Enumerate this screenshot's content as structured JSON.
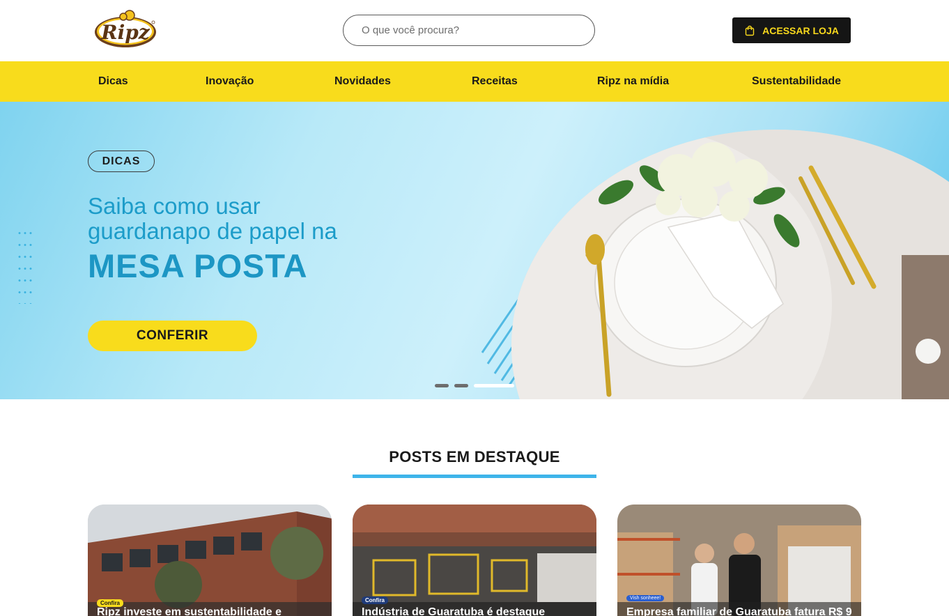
{
  "header": {
    "logo_text": "Ripz",
    "search_placeholder": "O que você procura?",
    "store_button": "ACESSAR LOJA"
  },
  "nav": {
    "items": [
      "Dicas",
      "Inovação",
      "Novidades",
      "Receitas",
      "Ripz na mídia",
      "Sustentabilidade"
    ]
  },
  "hero": {
    "tag": "DICAS",
    "line1": "Saiba como usar",
    "line2": "guardanapo de papel na",
    "line3": "MESA POSTA",
    "cta": "CONFERIR",
    "slides_total": 3,
    "active_slide": 3
  },
  "posts": {
    "section_title": "POSTS EM DESTAQUE",
    "cards": [
      {
        "badge": "Confira",
        "title": "Ripz investe em sustentabilidade e"
      },
      {
        "badge": "Confira",
        "title": "Indústria de Guaratuba é destaque"
      },
      {
        "badge": "Vish sonheee!",
        "title": "Empresa familiar de Guaratuba fatura R$ 9"
      }
    ]
  },
  "colors": {
    "brand_yellow": "#f8dc1c",
    "hero_blue_text": "#1c9cc9",
    "accent_blue": "#3eb4ea",
    "dark": "#151515"
  }
}
